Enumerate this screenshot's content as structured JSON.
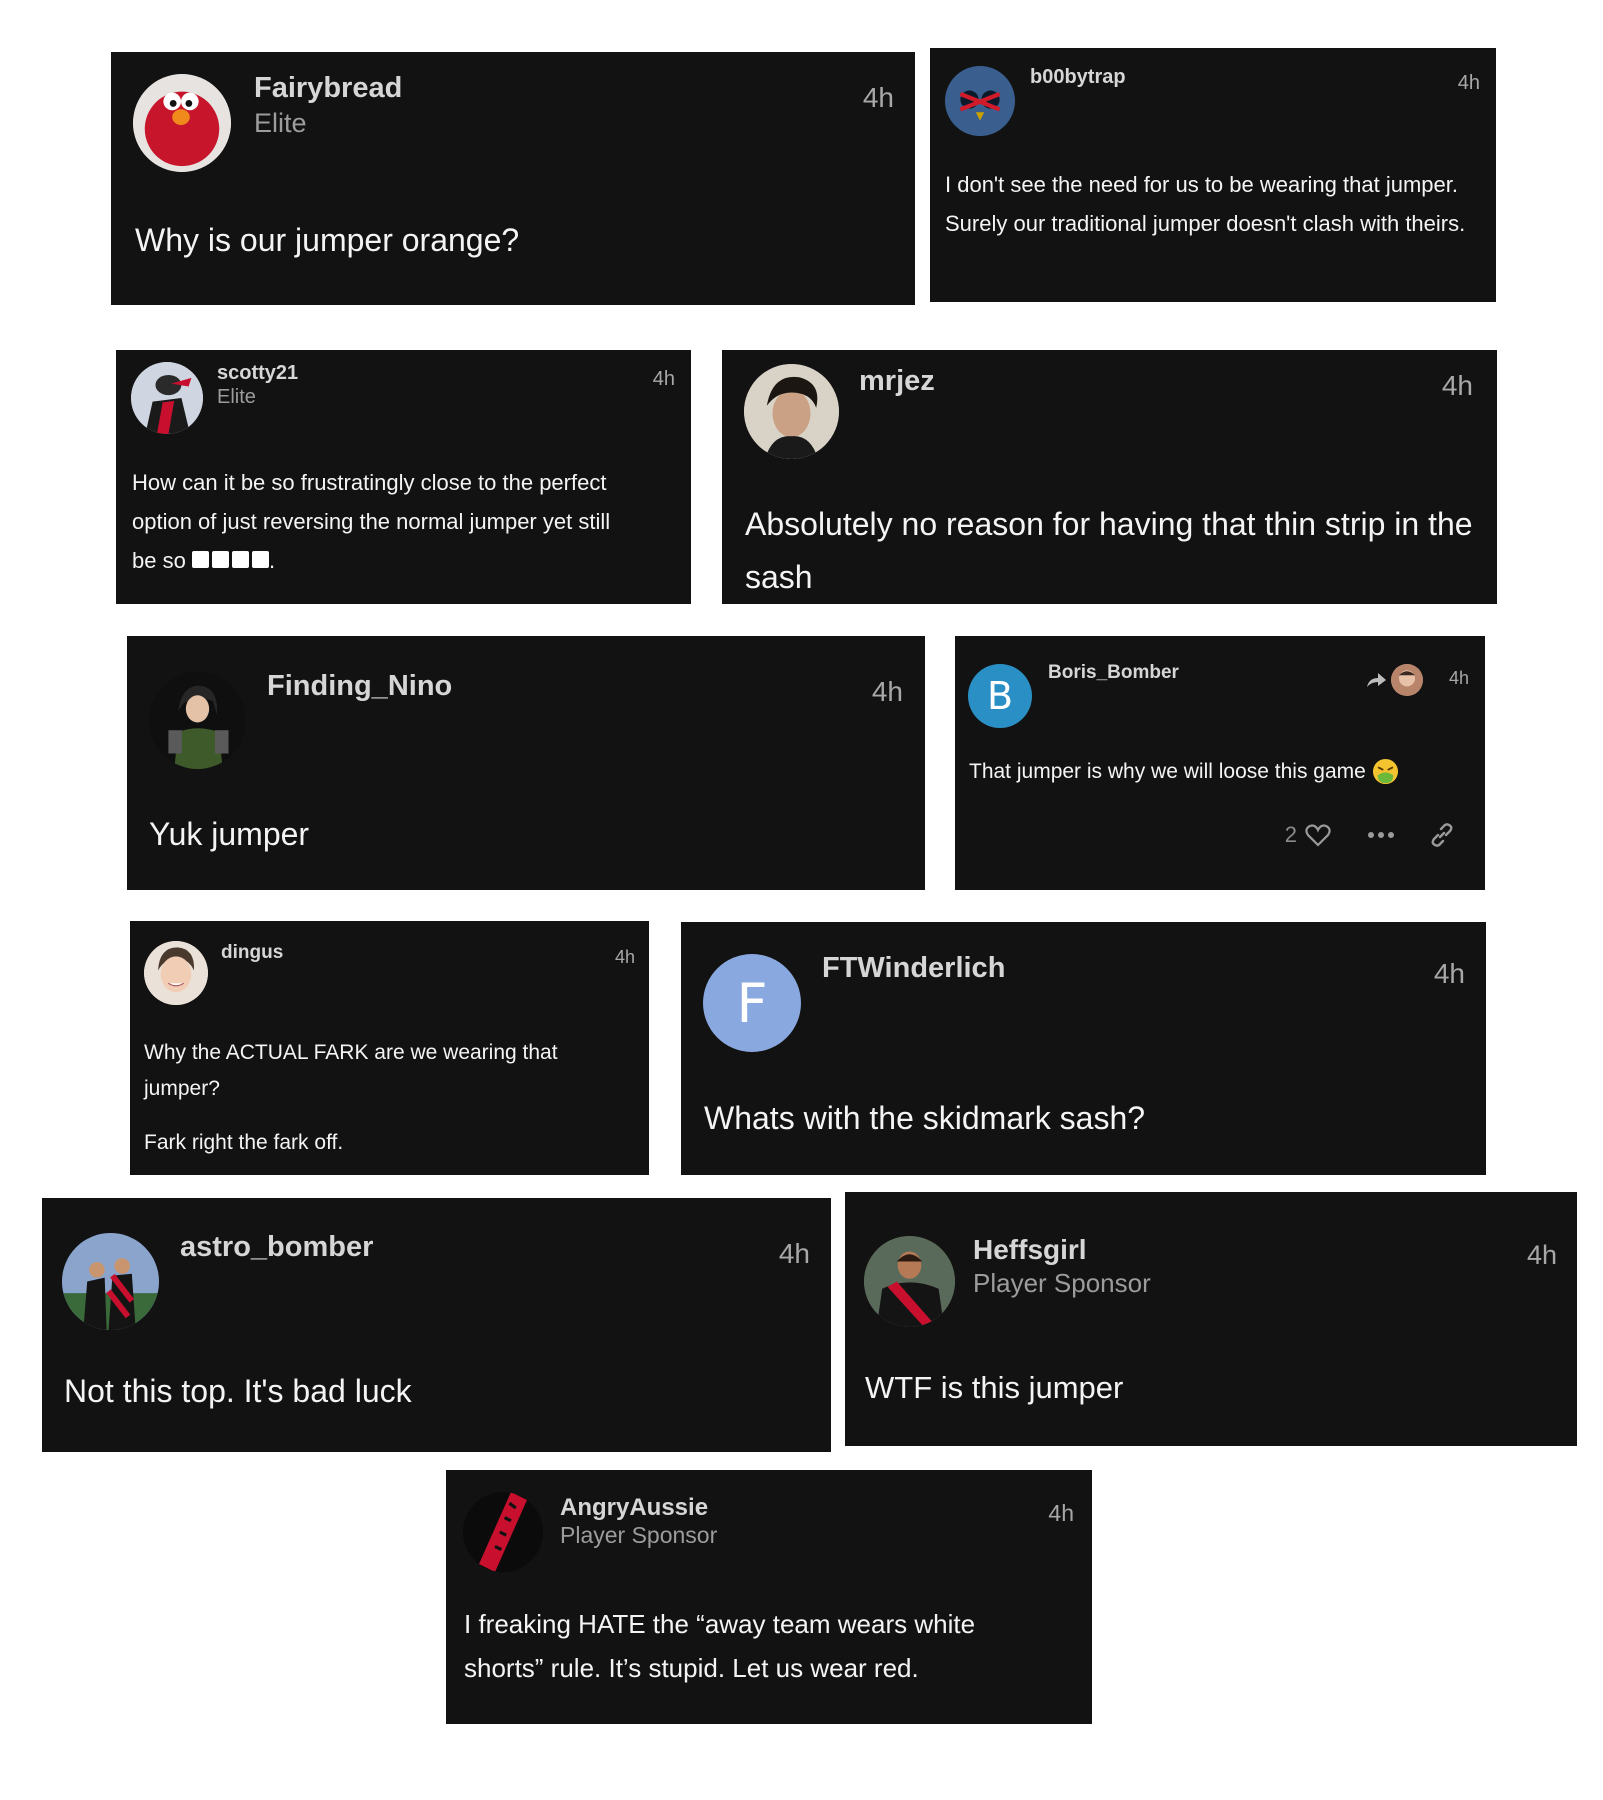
{
  "posts": [
    {
      "user": "Fairybread",
      "role": "Elite",
      "time": "4h",
      "text": "Why is our jumper orange?"
    },
    {
      "user": "b00bytrap",
      "time": "4h",
      "text": "I don't see the need for us to be wearing that jumper. Surely our traditional jumper doesn't clash with theirs."
    },
    {
      "user": "scotty21",
      "role": "Elite",
      "time": "4h",
      "text_lines": [
        "How can it be so frustratingly close to the perfect",
        "option of just reversing the normal jumper yet still",
        "be so "
      ],
      "text_end": "."
    },
    {
      "user": "mrjez",
      "time": "4h",
      "text": "Absolutely no reason for having that thin strip in the sash"
    },
    {
      "user": "Finding_Nino",
      "time": "4h",
      "text": "Yuk jumper"
    },
    {
      "user": "Boris_Bomber",
      "avatar_letter": "B",
      "time": "4h",
      "text": "That jumper is why we will loose this game",
      "like_count": "2",
      "icons": [
        "share-arrow-icon",
        "heart-icon",
        "more-icon",
        "link-icon",
        "sick-emoji-icon"
      ]
    },
    {
      "user": "dingus",
      "time": "4h",
      "text": "Why the ACTUAL FARK are we wearing that jumper?",
      "text2": "Fark right the fark off."
    },
    {
      "user": "FTWinderlich",
      "avatar_letter": "F",
      "time": "4h",
      "text": "Whats with the skidmark sash?"
    },
    {
      "user": "astro_bomber",
      "time": "4h",
      "text": "Not this top. It's bad luck"
    },
    {
      "user": "Heffsgirl",
      "role": "Player Sponsor",
      "time": "4h",
      "text": "WTF is this jumper"
    },
    {
      "user": "AngryAussie",
      "role": "Player Sponsor",
      "time": "4h",
      "text": "I freaking HATE the “away team wears white shorts” rule. It’s stupid. Let us wear red."
    }
  ],
  "colors": {
    "card_bg": "#121212",
    "accent_blue": "#2a8fc4",
    "accent_lavender": "#8aa8e0",
    "essendon_red": "#c8102e"
  }
}
